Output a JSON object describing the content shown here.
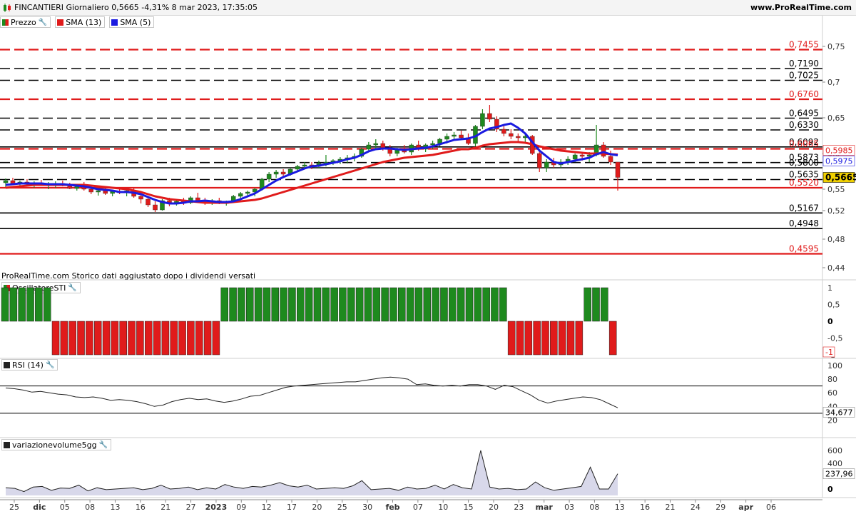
{
  "header": {
    "title": "FINCANTIERI Giornaliero 0,5665 -4,31% 8 mar 2023, 17:35:05",
    "brand": "www.ProRealTime.com"
  },
  "legend": {
    "price": "Prezzo",
    "sma13": "SMA (13)",
    "sma5": "SMA (5)"
  },
  "note": "ProRealTime.com  Storico dati aggiustato dopo i dividendi versati",
  "panels": {
    "osc": "OscillatoreSTI",
    "rsi": "RSI (14)",
    "vol": "variazionevolume5gg"
  },
  "colors": {
    "up": "#1e8a1e",
    "down": "#e01b1b",
    "sma13": "#e01b1b",
    "sma5": "#1a1ae0",
    "current": "#f0d000"
  },
  "chart_data": [
    {
      "type": "candlestick",
      "title": "FINCANTIERI Giornaliero",
      "ylim": [
        0.425,
        0.775
      ],
      "y_ticks": [
        0.75,
        0.7,
        0.65,
        0.6,
        0.55,
        0.52,
        0.48,
        0.44
      ],
      "x_tick_labels": [
        "25",
        "dic",
        "05",
        "08",
        "13",
        "16",
        "21",
        "27",
        "2023",
        "09",
        "12",
        "17",
        "20",
        "25",
        "30",
        "feb",
        "07",
        "10",
        "15",
        "20",
        "23",
        "mar",
        "03",
        "08",
        "13",
        "16",
        "21",
        "24",
        "29",
        "apr",
        "06"
      ],
      "levels": [
        {
          "value": 0.7455,
          "label": "0,7455",
          "color": "red",
          "style": "dashed"
        },
        {
          "value": 0.719,
          "label": "0,7190",
          "color": "black",
          "style": "dashed"
        },
        {
          "value": 0.7025,
          "label": "0,7025",
          "color": "black",
          "style": "dashed"
        },
        {
          "value": 0.676,
          "label": "0,6760",
          "color": "red",
          "style": "dashed"
        },
        {
          "value": 0.6495,
          "label": "0,6495",
          "color": "black",
          "style": "dashed"
        },
        {
          "value": 0.633,
          "label": "0,6330",
          "color": "black",
          "style": "dashed"
        },
        {
          "value": 0.6092,
          "label": "0,6092",
          "color": "black",
          "style": "solid"
        },
        {
          "value": 0.6065,
          "label": "0,6065",
          "color": "red",
          "style": "dashed"
        },
        {
          "value": 0.5873,
          "label": "0,5873",
          "color": "black",
          "style": "dashed"
        },
        {
          "value": 0.58,
          "label": "0,5800",
          "color": "black",
          "style": "solid"
        },
        {
          "value": 0.5635,
          "label": "0,5635",
          "color": "black",
          "style": "dashed"
        },
        {
          "value": 0.552,
          "label": "0,5520",
          "color": "red",
          "style": "solid"
        },
        {
          "value": 0.5167,
          "label": "0,5167",
          "color": "black",
          "style": "solid"
        },
        {
          "value": 0.4948,
          "label": "0,4948",
          "color": "black",
          "style": "solid"
        },
        {
          "value": 0.4595,
          "label": "0,4595",
          "color": "red",
          "style": "solid"
        }
      ],
      "right_badges": [
        {
          "label": "0,5985",
          "value": 0.5985,
          "color": "red"
        },
        {
          "label": "0,5975",
          "value": 0.5975,
          "color": "blue"
        },
        {
          "label": "0,5665",
          "value": 0.5665,
          "color": "current"
        }
      ],
      "candles": [
        [
          0.559,
          0.565,
          0.553,
          0.562
        ],
        [
          0.562,
          0.566,
          0.556,
          0.558
        ],
        [
          0.558,
          0.562,
          0.553,
          0.56
        ],
        [
          0.56,
          0.564,
          0.555,
          0.557
        ],
        [
          0.557,
          0.561,
          0.552,
          0.559
        ],
        [
          0.559,
          0.563,
          0.555,
          0.556
        ],
        [
          0.556,
          0.56,
          0.55,
          0.557
        ],
        [
          0.557,
          0.561,
          0.552,
          0.558
        ],
        [
          0.558,
          0.562,
          0.554,
          0.556
        ],
        [
          0.556,
          0.559,
          0.55,
          0.551
        ],
        [
          0.551,
          0.556,
          0.548,
          0.555
        ],
        [
          0.555,
          0.56,
          0.548,
          0.55
        ],
        [
          0.55,
          0.553,
          0.543,
          0.546
        ],
        [
          0.546,
          0.55,
          0.541,
          0.548
        ],
        [
          0.548,
          0.551,
          0.542,
          0.544
        ],
        [
          0.544,
          0.549,
          0.54,
          0.547
        ],
        [
          0.547,
          0.551,
          0.543,
          0.545
        ],
        [
          0.545,
          0.55,
          0.54,
          0.548
        ],
        [
          0.548,
          0.552,
          0.538,
          0.54
        ],
        [
          0.54,
          0.544,
          0.53,
          0.536
        ],
        [
          0.536,
          0.54,
          0.525,
          0.528
        ],
        [
          0.528,
          0.533,
          0.518,
          0.521
        ],
        [
          0.521,
          0.536,
          0.52,
          0.534
        ],
        [
          0.534,
          0.538,
          0.526,
          0.53
        ],
        [
          0.53,
          0.535,
          0.527,
          0.533
        ],
        [
          0.533,
          0.538,
          0.528,
          0.531
        ],
        [
          0.531,
          0.54,
          0.529,
          0.538
        ],
        [
          0.538,
          0.545,
          0.532,
          0.534
        ],
        [
          0.534,
          0.538,
          0.528,
          0.531
        ],
        [
          0.531,
          0.536,
          0.528,
          0.534
        ],
        [
          0.534,
          0.538,
          0.529,
          0.53
        ],
        [
          0.53,
          0.534,
          0.527,
          0.533
        ],
        [
          0.533,
          0.542,
          0.531,
          0.54
        ],
        [
          0.54,
          0.546,
          0.536,
          0.544
        ],
        [
          0.544,
          0.548,
          0.54,
          0.546
        ],
        [
          0.546,
          0.552,
          0.54,
          0.55
        ],
        [
          0.55,
          0.566,
          0.548,
          0.564
        ],
        [
          0.564,
          0.574,
          0.56,
          0.571
        ],
        [
          0.571,
          0.577,
          0.566,
          0.574
        ],
        [
          0.574,
          0.578,
          0.568,
          0.571
        ],
        [
          0.571,
          0.58,
          0.569,
          0.578
        ],
        [
          0.578,
          0.584,
          0.574,
          0.582
        ],
        [
          0.582,
          0.588,
          0.578,
          0.584
        ],
        [
          0.584,
          0.588,
          0.578,
          0.582
        ],
        [
          0.582,
          0.59,
          0.58,
          0.586
        ],
        [
          0.586,
          0.598,
          0.582,
          0.588
        ],
        [
          0.588,
          0.592,
          0.584,
          0.59
        ],
        [
          0.59,
          0.595,
          0.585,
          0.592
        ],
        [
          0.592,
          0.598,
          0.586,
          0.594
        ],
        [
          0.594,
          0.6,
          0.589,
          0.596
        ],
        [
          0.596,
          0.608,
          0.594,
          0.606
        ],
        [
          0.606,
          0.616,
          0.604,
          0.612
        ],
        [
          0.612,
          0.62,
          0.606,
          0.614
        ],
        [
          0.614,
          0.618,
          0.604,
          0.608
        ],
        [
          0.608,
          0.612,
          0.596,
          0.6
        ],
        [
          0.6,
          0.608,
          0.596,
          0.606
        ],
        [
          0.606,
          0.612,
          0.6,
          0.602
        ],
        [
          0.602,
          0.614,
          0.598,
          0.612
        ],
        [
          0.612,
          0.618,
          0.604,
          0.606
        ],
        [
          0.606,
          0.614,
          0.602,
          0.612
        ],
        [
          0.612,
          0.618,
          0.606,
          0.614
        ],
        [
          0.614,
          0.622,
          0.61,
          0.62
        ],
        [
          0.62,
          0.628,
          0.614,
          0.624
        ],
        [
          0.624,
          0.63,
          0.618,
          0.626
        ],
        [
          0.626,
          0.632,
          0.62,
          0.622
        ],
        [
          0.622,
          0.628,
          0.612,
          0.614
        ],
        [
          0.614,
          0.64,
          0.61,
          0.638
        ],
        [
          0.638,
          0.662,
          0.634,
          0.656
        ],
        [
          0.656,
          0.668,
          0.644,
          0.648
        ],
        [
          0.648,
          0.652,
          0.63,
          0.634
        ],
        [
          0.634,
          0.64,
          0.624,
          0.628
        ],
        [
          0.628,
          0.634,
          0.62,
          0.624
        ],
        [
          0.624,
          0.628,
          0.616,
          0.622
        ],
        [
          0.622,
          0.628,
          0.616,
          0.624
        ],
        [
          0.624,
          0.626,
          0.598,
          0.6
        ],
        [
          0.6,
          0.604,
          0.574,
          0.58
        ],
        [
          0.58,
          0.592,
          0.574,
          0.588
        ],
        [
          0.588,
          0.594,
          0.58,
          0.584
        ],
        [
          0.584,
          0.592,
          0.58,
          0.588
        ],
        [
          0.588,
          0.596,
          0.584,
          0.592
        ],
        [
          0.592,
          0.6,
          0.588,
          0.598
        ],
        [
          0.598,
          0.602,
          0.59,
          0.596
        ],
        [
          0.596,
          0.602,
          0.588,
          0.598
        ],
        [
          0.598,
          0.64,
          0.596,
          0.612
        ],
        [
          0.612,
          0.616,
          0.594,
          0.596
        ],
        [
          0.596,
          0.604,
          0.584,
          0.588
        ],
        [
          0.588,
          0.574,
          0.548,
          0.5665
        ]
      ],
      "sma13": [
        0.552,
        0.553,
        0.554,
        0.555,
        0.556,
        0.556,
        0.556,
        0.556,
        0.556,
        0.556,
        0.556,
        0.556,
        0.555,
        0.554,
        0.553,
        0.552,
        0.551,
        0.55,
        0.548,
        0.546,
        0.543,
        0.54,
        0.538,
        0.536,
        0.535,
        0.534,
        0.533,
        0.532,
        0.531,
        0.531,
        0.531,
        0.531,
        0.532,
        0.533,
        0.534,
        0.535,
        0.537,
        0.54,
        0.543,
        0.546,
        0.549,
        0.552,
        0.555,
        0.558,
        0.561,
        0.564,
        0.567,
        0.57,
        0.573,
        0.576,
        0.579,
        0.582,
        0.585,
        0.588,
        0.59,
        0.592,
        0.594,
        0.595,
        0.596,
        0.597,
        0.598,
        0.6,
        0.602,
        0.604,
        0.606,
        0.606,
        0.608,
        0.611,
        0.613,
        0.614,
        0.615,
        0.616,
        0.616,
        0.615,
        0.613,
        0.61,
        0.608,
        0.606,
        0.604,
        0.603,
        0.602,
        0.601,
        0.6,
        0.6,
        0.6,
        0.599,
        0.5985
      ],
      "sma5": [
        0.556,
        0.557,
        0.558,
        0.558,
        0.558,
        0.558,
        0.557,
        0.557,
        0.557,
        0.556,
        0.555,
        0.554,
        0.552,
        0.55,
        0.549,
        0.548,
        0.546,
        0.546,
        0.545,
        0.543,
        0.539,
        0.535,
        0.532,
        0.53,
        0.53,
        0.531,
        0.533,
        0.533,
        0.534,
        0.533,
        0.532,
        0.532,
        0.533,
        0.536,
        0.54,
        0.544,
        0.55,
        0.556,
        0.562,
        0.567,
        0.571,
        0.575,
        0.579,
        0.582,
        0.583,
        0.585,
        0.587,
        0.589,
        0.592,
        0.594,
        0.598,
        0.603,
        0.606,
        0.607,
        0.607,
        0.606,
        0.605,
        0.606,
        0.607,
        0.608,
        0.61,
        0.613,
        0.616,
        0.619,
        0.62,
        0.621,
        0.624,
        0.63,
        0.635,
        0.637,
        0.64,
        0.642,
        0.636,
        0.628,
        0.616,
        0.604,
        0.596,
        0.588,
        0.586,
        0.588,
        0.59,
        0.592,
        0.594,
        0.599,
        0.602,
        0.599,
        0.5975
      ]
    },
    {
      "type": "bar",
      "title": "OscillatoreSTI",
      "ylim": [
        -1,
        1
      ],
      "y_ticks": [
        "1",
        "0,5",
        "0",
        "-0,5",
        "-1"
      ],
      "values": [
        1,
        1,
        1,
        1,
        1,
        1,
        -1,
        -1,
        -1,
        -1,
        -1,
        -1,
        -1,
        -1,
        -1,
        -1,
        -1,
        -1,
        -1,
        -1,
        -1,
        -1,
        -1,
        -1,
        -1,
        -1,
        1,
        1,
        1,
        1,
        1,
        1,
        1,
        1,
        1,
        1,
        1,
        1,
        1,
        1,
        1,
        1,
        1,
        1,
        1,
        1,
        1,
        1,
        1,
        1,
        1,
        1,
        1,
        1,
        1,
        1,
        1,
        1,
        1,
        1,
        -1,
        -1,
        -1,
        -1,
        -1,
        -1,
        -1,
        -1,
        -1,
        1,
        1,
        1,
        -1
      ],
      "current_label": "-1"
    },
    {
      "type": "line",
      "title": "RSI (14)",
      "ylim": [
        10,
        100
      ],
      "y_ticks": [
        "100",
        "80",
        "60",
        "40",
        "20"
      ],
      "reference": 70,
      "current_label": "34,677",
      "values": [
        67,
        66,
        64,
        61,
        62,
        60,
        58,
        57,
        54,
        53,
        54,
        52,
        49,
        50,
        49,
        47,
        44,
        40,
        42,
        47,
        50,
        52,
        50,
        51,
        48,
        46,
        48,
        51,
        55,
        56,
        60,
        64,
        68,
        70,
        71,
        72,
        73,
        74,
        75,
        76,
        76,
        78,
        80,
        82,
        83,
        82,
        80,
        72,
        73,
        71,
        70,
        71,
        70,
        72,
        72,
        70,
        65,
        71,
        69,
        63,
        57,
        49,
        45,
        48,
        50,
        52,
        54,
        53,
        50,
        44,
        38
      ]
    },
    {
      "type": "area",
      "title": "variazionevolume5gg",
      "ylim": [
        -100,
        700
      ],
      "y_ticks": [
        "600",
        "400",
        "200",
        "0"
      ],
      "current_label": "237,96",
      "values": [
        20,
        10,
        -40,
        30,
        40,
        -20,
        15,
        10,
        60,
        -30,
        20,
        -10,
        0,
        10,
        20,
        -10,
        10,
        60,
        0,
        10,
        30,
        -10,
        20,
        0,
        70,
        30,
        10,
        40,
        30,
        60,
        100,
        50,
        30,
        60,
        0,
        10,
        20,
        10,
        50,
        130,
        -10,
        0,
        10,
        -20,
        30,
        0,
        10,
        60,
        0,
        70,
        20,
        0,
        600,
        30,
        0,
        10,
        -10,
        0,
        110,
        20,
        -20,
        0,
        20,
        40,
        340,
        0,
        0,
        238
      ]
    }
  ]
}
